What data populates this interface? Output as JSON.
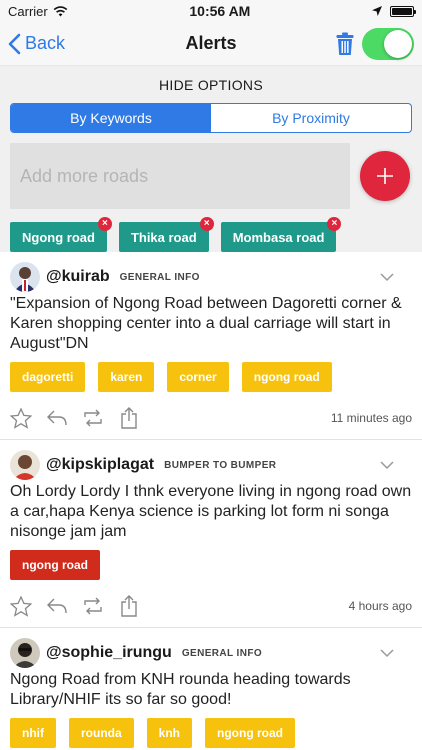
{
  "status_bar": {
    "carrier": "Carrier",
    "time": "10:56 AM",
    "battery_level": 1.0
  },
  "nav": {
    "back_label": "Back",
    "title": "Alerts",
    "toggle_on": true
  },
  "options": {
    "hide_label": "HIDE OPTIONS",
    "segments": [
      "By Keywords",
      "By Proximity"
    ],
    "active_segment": "By Keywords",
    "road_input_placeholder": "Add more roads",
    "add_symbol": "+",
    "road_tags": [
      "Ngong road",
      "Thika road",
      "Mombasa road"
    ],
    "remove_symbol": "×"
  },
  "posts": [
    {
      "username": "@kuirab",
      "category": "GENERAL INFO",
      "text": "\"Expansion of Ngong Road between Dagoretti corner & Karen shopping center into a dual carriage will start in August\"DN",
      "tags": [
        "dagoretti",
        "karen",
        "corner",
        "ngong road"
      ],
      "time": "11 minutes ago"
    },
    {
      "username": "@kipskiplagat",
      "category": "BUMPER TO BUMPER",
      "text": "Oh Lordy Lordy I thnk everyone living in ngong road own a car,hapa Kenya science is parking lot form ni songa nisonge jam jam",
      "tags": [
        "ngong road"
      ],
      "time": "4 hours ago"
    },
    {
      "username": "@sophie_irungu",
      "category": "GENERAL INFO",
      "text": "Ngong Road from KNH rounda heading towards Library/NHIF its so far so good!",
      "tags": [
        "nhif",
        "rounda",
        "knh",
        "ngong road"
      ]
    }
  ],
  "colors": {
    "accent": "#2f7ae5",
    "add_button": "#e0263c",
    "road_tag": "#1f9a8a",
    "keyword_tag": "#f7c20e",
    "highlight_tag": "#d12b1c",
    "toggle": "#4cd964"
  }
}
